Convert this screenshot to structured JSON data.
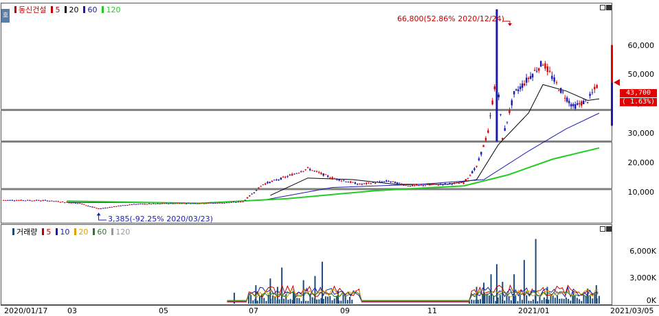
{
  "price_panel": {
    "stock_name": "동신건설",
    "ma_labels": [
      {
        "label": "5",
        "color": "#c00000"
      },
      {
        "label": "20",
        "color": "#000000"
      },
      {
        "label": "60",
        "color": "#1a1ab0"
      },
      {
        "label": "120",
        "color": "#22cc22"
      }
    ],
    "side_tab_label": "호",
    "high_annotation": "66,800(52.86% 2020/12/24)",
    "low_annotation": "3,385(-92.25% 2020/03/23)",
    "current_price": "43,700",
    "current_change": "( 1.63%)",
    "y_ticks": [
      "60,000",
      "50,000",
      "40,000",
      "30,000",
      "20,000",
      "10,000"
    ],
    "y_values": [
      60000,
      50000,
      40000,
      30000,
      20000,
      10000
    ]
  },
  "volume_panel": {
    "title": "거래량",
    "ma_labels": [
      {
        "label": "5",
        "color": "#c00000"
      },
      {
        "label": "10",
        "color": "#1a1ab0"
      },
      {
        "label": "20",
        "color": "#e0a000"
      },
      {
        "label": "60",
        "color": "#2a7a2a"
      },
      {
        "label": "120",
        "color": "#999999"
      }
    ],
    "y_ticks": [
      "6,000K",
      "3,000K",
      "0K"
    ]
  },
  "x_axis": {
    "labels": [
      "2020/01/17",
      "03",
      "05",
      "07",
      "09",
      "11",
      "2021/01",
      "2021/03/05"
    ]
  },
  "colors": {
    "up": "#e00000",
    "down": "#1a1ab0",
    "ma5": "#c00000",
    "ma20": "#000000",
    "ma60": "#1a1ab0",
    "ma120": "#22cc22",
    "hline": "#808080",
    "volume_bar": "#1a4a7a"
  },
  "chart_data": {
    "type": "line",
    "title": "동신건설",
    "series": [
      {
        "name": "동신건설",
        "role": "close_approx",
        "points": [
          [
            "2020/01/17",
            6500
          ],
          [
            "2020/02/15",
            6400
          ],
          [
            "2020/03/10",
            5500
          ],
          [
            "2020/03/23",
            3800
          ],
          [
            "2020/04/15",
            5200
          ],
          [
            "2020/05/15",
            5500
          ],
          [
            "2020/06/15",
            5600
          ],
          [
            "2020/07/01",
            6000
          ],
          [
            "2020/07/15",
            11500
          ],
          [
            "2020/08/01",
            14000
          ],
          [
            "2020/08/15",
            16500
          ],
          [
            "2020/09/01",
            13500
          ],
          [
            "2020/09/20",
            11500
          ],
          [
            "2020/10/10",
            12500
          ],
          [
            "2020/10/25",
            11000
          ],
          [
            "2020/11/15",
            11500
          ],
          [
            "2020/12/01",
            12000
          ],
          [
            "2020/12/10",
            17000
          ],
          [
            "2020/12/18",
            28000
          ],
          [
            "2020/12/24",
            47000
          ],
          [
            "2020/12/28",
            26000
          ],
          [
            "2021/01/05",
            40000
          ],
          [
            "2021/01/15",
            45000
          ],
          [
            "2021/01/25",
            50000
          ],
          [
            "2021/02/05",
            42000
          ],
          [
            "2021/02/15",
            36000
          ],
          [
            "2021/02/25",
            38000
          ],
          [
            "2021/03/05",
            43700
          ]
        ]
      },
      {
        "name": "20",
        "points": [
          [
            "2020/07/20",
            8000
          ],
          [
            "2020/08/15",
            13500
          ],
          [
            "2020/09/15",
            13000
          ],
          [
            "2020/10/15",
            11500
          ],
          [
            "2020/11/20",
            11500
          ],
          [
            "2020/12/10",
            13000
          ],
          [
            "2020/12/25",
            24000
          ],
          [
            "2021/01/15",
            34000
          ],
          [
            "2021/01/25",
            43000
          ],
          [
            "2021/02/10",
            41000
          ],
          [
            "2021/02/25",
            38000
          ],
          [
            "2021/03/05",
            38500
          ]
        ]
      },
      {
        "name": "60",
        "points": [
          [
            "2020/03/01",
            5800
          ],
          [
            "2020/06/01",
            5600
          ],
          [
            "2020/07/15",
            6500
          ],
          [
            "2020/09/01",
            10500
          ],
          [
            "2020/11/01",
            11500
          ],
          [
            "2020/12/15",
            13000
          ],
          [
            "2021/01/15",
            22000
          ],
          [
            "2021/02/10",
            29000
          ],
          [
            "2021/03/05",
            34000
          ]
        ]
      },
      {
        "name": "120",
        "points": [
          [
            "2020/03/01",
            6200
          ],
          [
            "2020/06/01",
            5500
          ],
          [
            "2020/08/01",
            7000
          ],
          [
            "2020/10/01",
            9500
          ],
          [
            "2020/12/01",
            11000
          ],
          [
            "2021/01/01",
            14500
          ],
          [
            "2021/02/01",
            19500
          ],
          [
            "2021/03/05",
            23000
          ]
        ]
      }
    ],
    "horizontal_lines": [
      35000,
      25000,
      10000
    ],
    "ylim": [
      0,
      68000
    ],
    "volume": {
      "ylim": [
        0,
        8000
      ],
      "unit": "K",
      "bars": [
        [
          "2020/06/25",
          1300
        ],
        [
          "2020/07/10",
          2200
        ],
        [
          "2020/07/20",
          3000
        ],
        [
          "2020/07/25",
          2000
        ],
        [
          "2020/07/28",
          4300
        ],
        [
          "2020/08/05",
          1500
        ],
        [
          "2020/08/12",
          2800
        ],
        [
          "2020/08/20",
          3300
        ],
        [
          "2020/08/25",
          5000
        ],
        [
          "2020/09/05",
          1500
        ],
        [
          "2020/12/10",
          2000
        ],
        [
          "2020/12/15",
          2500
        ],
        [
          "2020/12/20",
          3500
        ],
        [
          "2020/12/24",
          4700
        ],
        [
          "2020/12/28",
          2600
        ],
        [
          "2021/01/05",
          3500
        ],
        [
          "2021/01/12",
          5200
        ],
        [
          "2021/01/20",
          7700
        ],
        [
          "2021/01/28",
          2000
        ],
        [
          "2021/02/15",
          1500
        ],
        [
          "2021/02/25",
          1800
        ],
        [
          "2021/03/03",
          2200
        ]
      ]
    }
  }
}
